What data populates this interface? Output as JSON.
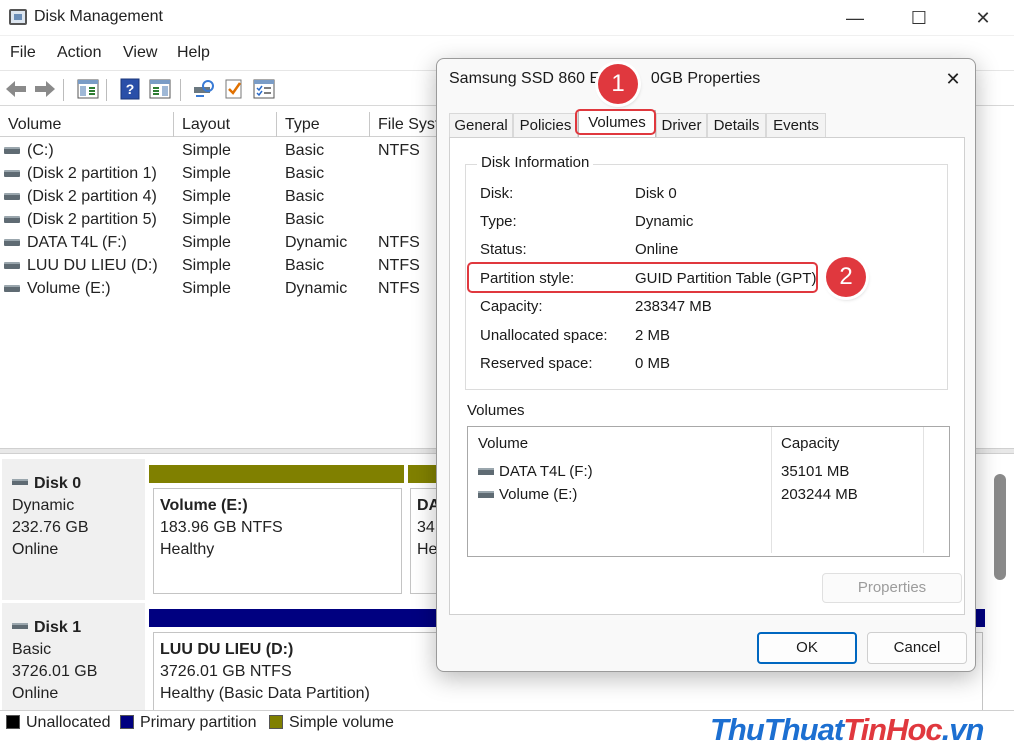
{
  "window": {
    "title": "Disk Management",
    "minimize": "—",
    "maximize": "☐",
    "close": "✕"
  },
  "menu": [
    "File",
    "Action",
    "View",
    "Help"
  ],
  "toolbar_icons": [
    "back-arrow-icon",
    "forward-arrow-icon",
    "console-tree-icon",
    "help-icon",
    "action-pane-icon",
    "rescan-icon",
    "check-icon",
    "properties-list-icon"
  ],
  "volume_table": {
    "columns": [
      "Volume",
      "Layout",
      "Type",
      "File Syst"
    ],
    "rows": [
      {
        "volume": "(C:)",
        "layout": "Simple",
        "type": "Basic",
        "fs": "NTFS"
      },
      {
        "volume": "(Disk 2 partition 1)",
        "layout": "Simple",
        "type": "Basic",
        "fs": ""
      },
      {
        "volume": "(Disk 2 partition 4)",
        "layout": "Simple",
        "type": "Basic",
        "fs": ""
      },
      {
        "volume": "(Disk 2 partition 5)",
        "layout": "Simple",
        "type": "Basic",
        "fs": ""
      },
      {
        "volume": "DATA T4L (F:)",
        "layout": "Simple",
        "type": "Dynamic",
        "fs": "NTFS"
      },
      {
        "volume": "LUU DU LIEU (D:)",
        "layout": "Simple",
        "type": "Basic",
        "fs": "NTFS"
      },
      {
        "volume": "Volume (E:)",
        "layout": "Simple",
        "type": "Dynamic",
        "fs": "NTFS"
      }
    ]
  },
  "disks": [
    {
      "name": "Disk 0",
      "type": "Dynamic",
      "size": "232.76 GB",
      "status": "Online",
      "partitions": [
        {
          "name": "Volume  (E:)",
          "size_fs": "183.96 GB NTFS",
          "status": "Healthy"
        },
        {
          "name": "DA",
          "size_fs": "34.",
          "status": "He"
        }
      ]
    },
    {
      "name": "Disk 1",
      "type": "Basic",
      "size": "3726.01 GB",
      "status": "Online",
      "partitions": [
        {
          "name": "LUU DU LIEU  (D:)",
          "size_fs": "3726.01 GB NTFS",
          "status": "Healthy (Basic Data Partition)"
        }
      ]
    }
  ],
  "legend": [
    {
      "label": "Unallocated",
      "color": "#000000"
    },
    {
      "label": "Primary partition",
      "color": "#000080"
    },
    {
      "label": "Simple volume",
      "color": "#808000"
    }
  ],
  "colors": {
    "simple_volume": "#808000",
    "primary_partition": "#000080",
    "callout": "#e0383e",
    "accent": "#0067c0"
  },
  "watermark": {
    "part1": "Thu",
    "part2": "Thuat",
    "part3": "TinHoc",
    "part4": ".vn"
  },
  "dialog": {
    "title": "Samsung SSD 860 EV",
    "title_rest": "0GB Properties",
    "close": "✕",
    "tabs": [
      "General",
      "Policies",
      "Volumes",
      "Driver",
      "Details",
      "Events"
    ],
    "active_tab": "Volumes",
    "disk_info": {
      "heading": "Disk Information",
      "rows": [
        {
          "label": "Disk:",
          "value": "Disk 0"
        },
        {
          "label": "Type:",
          "value": "Dynamic"
        },
        {
          "label": "Status:",
          "value": "Online"
        },
        {
          "label": "Partition style:",
          "value": "GUID Partition Table (GPT)"
        },
        {
          "label": "Capacity:",
          "value": "238347 MB"
        },
        {
          "label": "Unallocated space:",
          "value": "2 MB"
        },
        {
          "label": "Reserved space:",
          "value": "0 MB"
        }
      ]
    },
    "volumes_label": "Volumes",
    "volumes_list": {
      "columns": [
        "Volume",
        "Capacity"
      ],
      "rows": [
        {
          "volume": "DATA T4L (F:)",
          "capacity": "35101 MB"
        },
        {
          "volume": "Volume (E:)",
          "capacity": "203244 MB"
        }
      ]
    },
    "properties_button": "Properties",
    "ok_button": "OK",
    "cancel_button": "Cancel"
  },
  "callouts": [
    "1",
    "2"
  ]
}
